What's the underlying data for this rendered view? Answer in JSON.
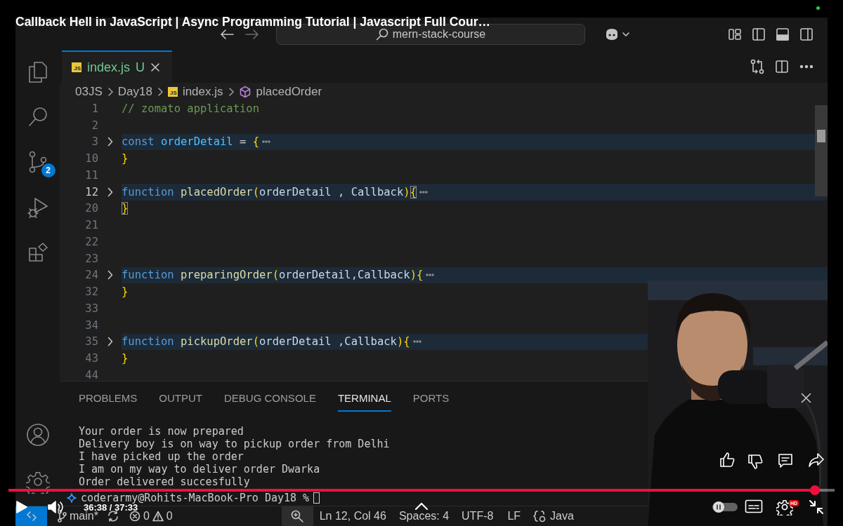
{
  "player": {
    "title": "Callback Hell in JavaScript | Async Programming Tutorial | Javascript Full Cour…",
    "time": "36:38 / 37:33",
    "level": 0.976,
    "hd_badge": "HD"
  },
  "titlebar": {
    "search": "mern-stack-course"
  },
  "activity_bar": {
    "source_control_badge": "2"
  },
  "tab": {
    "icon_label": "JS",
    "label": "index.js",
    "status": "U"
  },
  "breadcrumbs": [
    {
      "kind": "folder",
      "text": "03JS"
    },
    {
      "kind": "folder",
      "text": "Day18"
    },
    {
      "kind": "file",
      "icon_label": "JS",
      "text": "index.js"
    },
    {
      "kind": "symbol",
      "text": "placedOrder"
    }
  ],
  "lines": [
    {
      "number": "1",
      "folded": false,
      "current": false,
      "tokens": [
        {
          "kind": "comment",
          "text": "// zomato application"
        }
      ]
    },
    {
      "number": "2",
      "folded": false,
      "current": false
    },
    {
      "number": "3",
      "folded": true,
      "current": false,
      "tokens": [
        {
          "kind": "keyword",
          "text": "const"
        },
        {
          "kind": "variable",
          "text": " orderDetail"
        },
        {
          "kind": "punct",
          "text": " = "
        },
        {
          "kind": "brace",
          "text": "{"
        }
      ]
    },
    {
      "number": "10",
      "folded": false,
      "current": false,
      "tokens": [
        {
          "kind": "brace",
          "text": "}"
        }
      ]
    },
    {
      "number": "11",
      "folded": false,
      "current": false
    },
    {
      "number": "12",
      "folded": true,
      "current": true,
      "tokens": [
        {
          "kind": "keyword",
          "text": "function"
        },
        {
          "kind": "name",
          "text": " placedOrder"
        },
        {
          "kind": "brace",
          "text": "("
        },
        {
          "kind": "param",
          "text": "orderDetail , Callback"
        },
        {
          "kind": "brace",
          "text": ")"
        },
        {
          "kind": "matched-brace",
          "text": "{"
        }
      ]
    },
    {
      "number": "20",
      "folded": false,
      "current": false,
      "tokens": [
        {
          "kind": "matched-brace",
          "text": "}"
        }
      ]
    },
    {
      "number": "21",
      "folded": false,
      "current": false
    },
    {
      "number": "22",
      "folded": false,
      "current": false
    },
    {
      "number": "23",
      "folded": false,
      "current": false
    },
    {
      "number": "24",
      "folded": true,
      "current": false,
      "tokens": [
        {
          "kind": "keyword",
          "text": "function"
        },
        {
          "kind": "name",
          "text": " preparingOrder"
        },
        {
          "kind": "brace",
          "text": "("
        },
        {
          "kind": "param",
          "text": "orderDetail,Callback"
        },
        {
          "kind": "brace",
          "text": ")"
        },
        {
          "kind": "brace",
          "text": "{"
        }
      ]
    },
    {
      "number": "32",
      "folded": false,
      "current": false,
      "tokens": [
        {
          "kind": "brace",
          "text": "}"
        }
      ]
    },
    {
      "number": "33",
      "folded": false,
      "current": false
    },
    {
      "number": "34",
      "folded": false,
      "current": false
    },
    {
      "number": "35",
      "folded": true,
      "current": false,
      "tokens": [
        {
          "kind": "keyword",
          "text": "function"
        },
        {
          "kind": "name",
          "text": " pickupOrder"
        },
        {
          "kind": "brace",
          "text": "("
        },
        {
          "kind": "param",
          "text": "orderDetail ,Callback"
        },
        {
          "kind": "brace",
          "text": ")"
        },
        {
          "kind": "brace",
          "text": "{"
        }
      ]
    },
    {
      "number": "43",
      "folded": false,
      "current": false,
      "tokens": [
        {
          "kind": "brace",
          "text": "}"
        }
      ]
    },
    {
      "number": "44",
      "folded": false,
      "current": false
    }
  ],
  "panel": {
    "tabs": [
      {
        "label": "PROBLEMS",
        "selected": false
      },
      {
        "label": "OUTPUT",
        "selected": false
      },
      {
        "label": "DEBUG CONSOLE",
        "selected": false
      },
      {
        "label": "TERMINAL",
        "selected": true
      },
      {
        "label": "PORTS",
        "selected": false
      }
    ],
    "terminal": [
      "Your order is now prepared",
      "Delivery boy is on way to pickup order from Delhi",
      "I have picked up the order",
      "I am on my way to deliver order Dwarka",
      "Order delivered succesfully"
    ],
    "prompt": "coderarmy@Rohits-MacBook-Pro Day18 %"
  },
  "status_bar": {
    "branch": "main*",
    "errors": "0",
    "warnings": "0",
    "cursor": "Ln 12, Col 46",
    "indent": "Spaces: 4",
    "encoding": "UTF-8",
    "eol": "LF",
    "language": "Java"
  }
}
